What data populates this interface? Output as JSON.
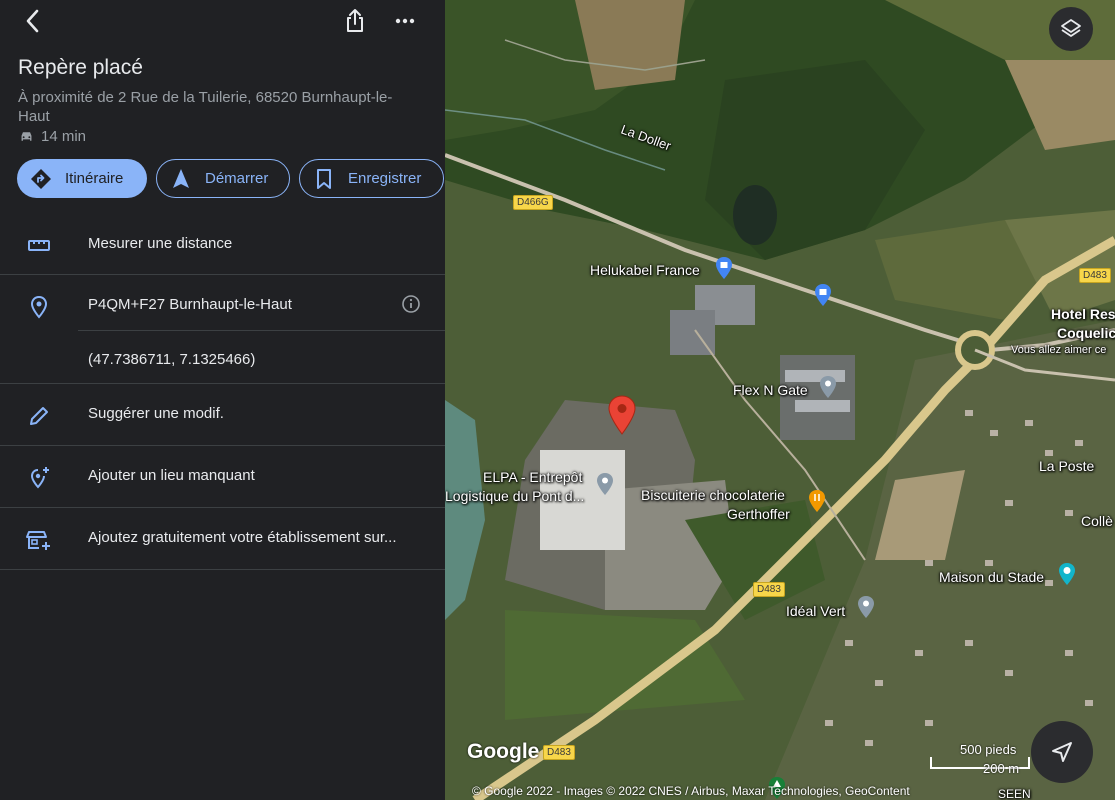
{
  "panel": {
    "title": "Repère placé",
    "address": "À proximité de 2 Rue de la Tuilerie, 68520 Burnhaupt-le-Haut",
    "duration": "14 min",
    "actions": {
      "itineraire": "Itinéraire",
      "demarrer": "Démarrer",
      "enregistrer": "Enregistrer"
    },
    "list": {
      "measure": "Mesurer une distance",
      "pluscode": "P4QM+F27 Burnhaupt-le-Haut",
      "coords": "(47.7386711, 7.1325466)",
      "suggest": "Suggérer une modif.",
      "add_place": "Ajouter un lieu manquant",
      "add_business": "Ajoutez gratuitement votre établissement sur..."
    }
  },
  "map": {
    "labels": {
      "river": "La Doller",
      "helukabel": "Helukabel France",
      "hotel": "Hotel Res",
      "coquelico": "Coquelico",
      "coquelico_sub": "Vous allez aimer ce",
      "flex": "Flex N Gate",
      "laposte": "La Poste",
      "elpa1": "ELPA - Entrepôt",
      "elpa2": "Logistique du Pont d...",
      "biscuit1": "Biscuiterie chocolaterie",
      "biscuit2": "Gerthoffer",
      "college": "Collè",
      "maison": "Maison du Stade",
      "ideal": "Idéal Vert",
      "seen": "SEEN"
    },
    "roads": {
      "d466g": "D466G",
      "d483_a": "D483",
      "d483_b": "D483",
      "d483_c": "D483"
    },
    "google": "Google",
    "copyright": "© Google 2022 - Images © 2022 CNES / Airbus, Maxar Technologies, GeoContent",
    "scale_ft": "500 pieds",
    "scale_m": "200 m"
  },
  "colors": {
    "accent": "#8ab4f8",
    "panel_bg": "#202124",
    "pin_red": "#ea4335"
  }
}
